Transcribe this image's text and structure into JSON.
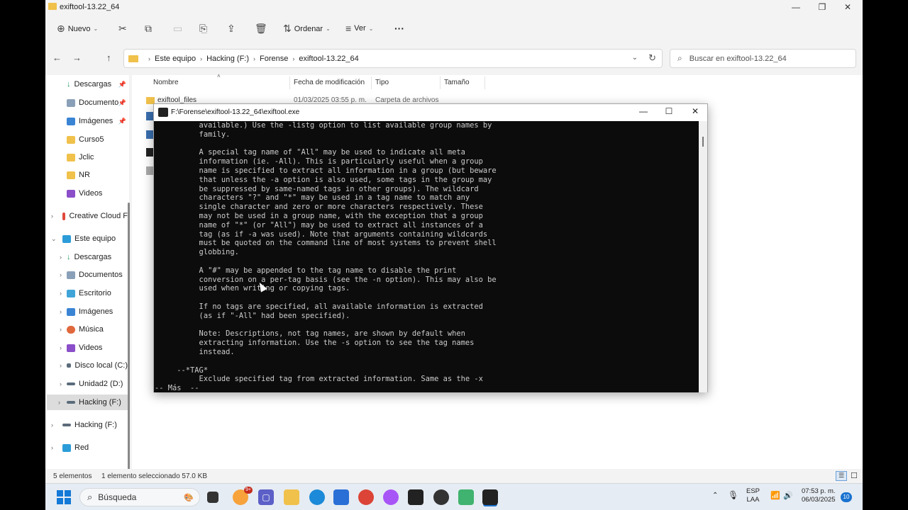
{
  "explorer": {
    "window_title": "exiftool-13.22_64",
    "controls": {
      "minimize": "—",
      "maximize": "❐",
      "close": "✕"
    },
    "toolbar": {
      "new_label": "Nuevo",
      "sort_label": "Ordenar",
      "view_label": "Ver",
      "more_label": "···"
    },
    "nav": {
      "back": "←",
      "forward": "→",
      "up": "↑"
    },
    "breadcrumb": [
      "Este equipo",
      "Hacking (F:)",
      "Forense",
      "exiftool-13.22_64"
    ],
    "search_placeholder": "Buscar en exiftool-13.22_64",
    "sidebar": {
      "quick_access": [
        {
          "label": "Descargas",
          "pinned": true
        },
        {
          "label": "Documento",
          "pinned": true
        },
        {
          "label": "Imágenes",
          "pinned": true
        },
        {
          "label": "Curso5",
          "pinned": false
        },
        {
          "label": "Jclic",
          "pinned": false
        },
        {
          "label": "NR",
          "pinned": false
        },
        {
          "label": "Videos",
          "pinned": false
        }
      ],
      "creative_cloud": "Creative Cloud F",
      "this_pc": "Este equipo",
      "this_pc_items": [
        "Descargas",
        "Documentos",
        "Escritorio",
        "Imágenes",
        "Música",
        "Videos",
        "Disco local (C:)",
        "Unidad2 (D:)",
        "Hacking (F:)"
      ],
      "hacking_drive": "Hacking (F:)",
      "network": "Red"
    },
    "columns": [
      "Nombre",
      "Fecha de modificación",
      "Tipo",
      "Tamaño"
    ],
    "rows": [
      {
        "name": "exiftool_files",
        "date": "01/03/2025 03:55 p. m.",
        "type": "Carpeta de archivos",
        "size": ""
      }
    ],
    "status": {
      "count": "5 elementos",
      "selected": "1 elemento seleccionado  57.0 KB"
    }
  },
  "console": {
    "title": "F:\\Forense\\exiftool-13.22_64\\exiftool.exe",
    "lines": [
      "          available.) Use the -listg option to list available group names by",
      "          family.",
      "",
      "          A special tag name of \"All\" may be used to indicate all meta",
      "          information (ie. -All). This is particularly useful when a group",
      "          name is specified to extract all information in a group (but beware",
      "          that unless the -a option is also used, some tags in the group may",
      "          be suppressed by same-named tags in other groups). The wildcard",
      "          characters \"?\" and \"*\" may be used in a tag name to match any",
      "          single character and zero or more characters respectively. These",
      "          may not be used in a group name, with the exception that a group",
      "          name of \"*\" (or \"All\") may be used to extract all instances of a",
      "          tag (as if -a was used). Note that arguments containing wildcards",
      "          must be quoted on the command line of most systems to prevent shell",
      "          globbing.",
      "",
      "          A \"#\" may be appended to the tag name to disable the print",
      "          conversion on a per-tag basis (see the -n option). This may also be",
      "          used when writing or copying tags.",
      "",
      "          If no tags are specified, all available information is extracted",
      "          (as if \"-All\" had been specified).",
      "",
      "          Note: Descriptions, not tag names, are shown by default when",
      "          extracting information. Use the -s option to see the tag names",
      "          instead.",
      "",
      "     --*TAG*",
      "          Exclude specified tag from extracted information. Same as the -x",
      "-- Más  --"
    ]
  },
  "taskbar": {
    "search_label": "Búsqueda",
    "badge_count": "9+",
    "language": "ESP",
    "language_sub": "LAA",
    "time": "07:53 p. m.",
    "date": "06/03/2025",
    "notifications": "10"
  }
}
